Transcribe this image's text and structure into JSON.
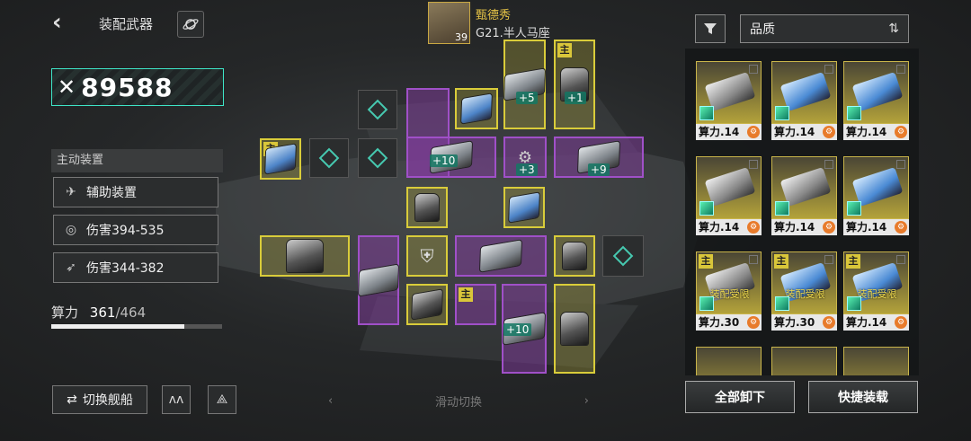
{
  "header": {
    "title": "装配武器",
    "captain_name": "甄德秀",
    "captain_level": "39",
    "ship_name": "G21.半人马座"
  },
  "power": {
    "value": "89588"
  },
  "active_section": {
    "heading": "主动装置",
    "items": [
      {
        "label": "辅助装置",
        "icon": "drone-icon"
      },
      {
        "label": "伤害394-535",
        "icon": "target-icon"
      },
      {
        "label": "伤害344-382",
        "icon": "missile-icon"
      }
    ]
  },
  "capacity": {
    "label": "算力",
    "used": "361",
    "total": "/464",
    "fraction": 0.778
  },
  "buttons": {
    "switch_ship": "切换舰船",
    "unload_all": "全部卸下",
    "quick_load": "快捷装载"
  },
  "swipe_hint": {
    "text": "滑动切换",
    "left": "‹",
    "right": "›"
  },
  "sort": {
    "label": "品质",
    "icon": "sort-icon"
  },
  "main_tag": "主",
  "slot_levels": {
    "a": "+5",
    "b": "+1",
    "c": "+10",
    "d": "+3",
    "e": "+9",
    "f": "+10"
  },
  "inventory": [
    {
      "cost": "算力.14",
      "main": false,
      "warn": ""
    },
    {
      "cost": "算力.14",
      "main": false,
      "warn": ""
    },
    {
      "cost": "算力.14",
      "main": false,
      "warn": ""
    },
    {
      "cost": "算力.14",
      "main": false,
      "warn": ""
    },
    {
      "cost": "算力.14",
      "main": false,
      "warn": ""
    },
    {
      "cost": "算力.14",
      "main": false,
      "warn": ""
    },
    {
      "cost": "算力.30",
      "main": true,
      "warn": "装配受限"
    },
    {
      "cost": "算力.30",
      "main": true,
      "warn": "装配受限"
    },
    {
      "cost": "算力.14",
      "main": true,
      "warn": "装配受限"
    }
  ],
  "colors": {
    "accent": "#3ee6c8",
    "yellow_slot": "#d9cc3a",
    "purple_slot": "#a050c8",
    "gold": "#e8c547"
  }
}
